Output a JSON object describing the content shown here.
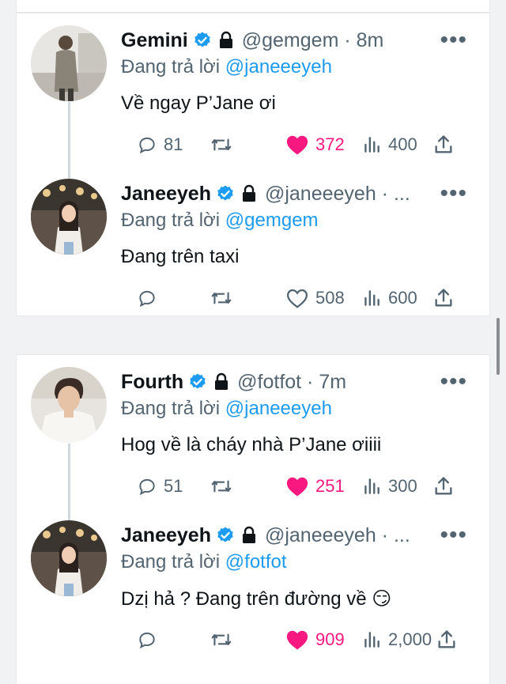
{
  "reply_prefix": "Đang trả lời",
  "threads": [
    {
      "tweets": [
        {
          "name": "Gemini",
          "handle_time": "@gemgem · 8m",
          "reply_to": "@janeeeyeh",
          "text": "Về ngay P’Jane ơi",
          "replies": "81",
          "retweets": "",
          "likes": "372",
          "liked": true,
          "views": "400",
          "avatar": "man-standing-photo"
        },
        {
          "name": "Janeeyeh",
          "handle_time": "@janeeeyeh · ...",
          "reply_to": "@gemgem",
          "text": "Đang trên taxi",
          "replies": "",
          "retweets": "",
          "likes": "508",
          "liked": false,
          "views": "600",
          "avatar": "woman-photo"
        }
      ]
    },
    {
      "tweets": [
        {
          "name": "Fourth",
          "handle_time": "@fotfot · 7m",
          "reply_to": "@janeeeyeh",
          "text": "Hog về là cháy nhà P’Jane ơiiii",
          "replies": "51",
          "retweets": "",
          "likes": "251",
          "liked": true,
          "views": "300",
          "avatar": "man-portrait-photo"
        },
        {
          "name": "Janeeyeh",
          "handle_time": "@janeeeyeh · ...",
          "reply_to": "@fotfot",
          "text": "Dzị hả ? Đang trên đường về 😏",
          "replies": "",
          "retweets": "",
          "likes": "909",
          "liked": true,
          "views": "2,000",
          "avatar": "woman-photo"
        }
      ]
    }
  ],
  "colors": {
    "accent": "#1d9bf0",
    "like": "#f91880",
    "muted": "#536471",
    "background": "#f1f2f4"
  }
}
